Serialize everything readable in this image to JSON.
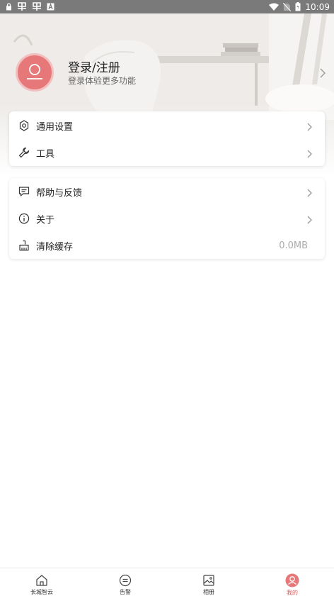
{
  "status_bar": {
    "time": "10:09",
    "left_icons": [
      "lock-icon",
      "notification-app-icon",
      "notification-app-icon",
      "font-a-icon"
    ],
    "right_icons": [
      "wifi-icon",
      "no-sim-icon",
      "battery-icon"
    ]
  },
  "profile": {
    "title": "登录/注册",
    "subtitle": "登录体验更多功能",
    "avatar_color": "#e7787a"
  },
  "menu_groups": [
    {
      "items": [
        {
          "icon": "settings-icon",
          "label": "通用设置"
        },
        {
          "icon": "wrench-icon",
          "label": "工具"
        }
      ]
    },
    {
      "items": [
        {
          "icon": "feedback-icon",
          "label": "帮助与反馈"
        },
        {
          "icon": "info-icon",
          "label": "关于"
        },
        {
          "icon": "broom-icon",
          "label": "清除缓存",
          "value": "0.0MB"
        }
      ]
    }
  ],
  "bottom_nav": {
    "items": [
      {
        "icon": "home-icon",
        "label": "长城智云"
      },
      {
        "icon": "message-icon",
        "label": "告警"
      },
      {
        "icon": "album-icon",
        "label": "相册"
      },
      {
        "icon": "profile-icon",
        "label": "我的",
        "active": true
      }
    ],
    "accent_color": "#e05a5c"
  }
}
